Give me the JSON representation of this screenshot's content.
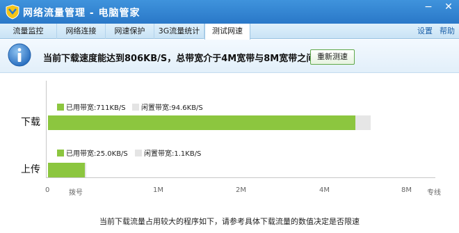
{
  "window": {
    "title": "网络流量管理 - 电脑管家",
    "minimize_glyph": "−",
    "close_glyph": "✕"
  },
  "tabs": [
    {
      "label": "流量监控",
      "active": false
    },
    {
      "label": "网络连接",
      "active": false
    },
    {
      "label": "网速保护",
      "active": false
    },
    {
      "label": "3G流量统计",
      "active": false
    },
    {
      "label": "测试网速",
      "active": true
    }
  ],
  "toplinks": {
    "settings": "设置",
    "help": "帮助"
  },
  "banner": {
    "message": "当前下载速度能达到806KB/S，总带宽介于4M宽带与8M宽带之间",
    "retest_label": "重新测速"
  },
  "download": {
    "label": "下载",
    "used_legend": "已用带宽:711KB/S",
    "idle_legend": "闲置带宽:94.6KB/S",
    "used_kbs": 711,
    "idle_kbs": 94.6
  },
  "upload": {
    "label": "上传",
    "used_legend": "已用带宽:25.0KB/S",
    "idle_legend": "闲置带宽:1.1KB/S",
    "used_kbs": 25.0,
    "idle_kbs": 1.1
  },
  "axis": {
    "ticks": [
      "0",
      "拨号",
      "1M",
      "2M",
      "4M",
      "8M",
      "专线"
    ]
  },
  "footer": {
    "message": "当前下载流量占用较大的程序如下，请参考具体下载流量的数值决定是否限速"
  },
  "colors": {
    "used": "#8cc63f",
    "idle": "#e6e6e6",
    "titlebar": "#2a78c8"
  }
}
